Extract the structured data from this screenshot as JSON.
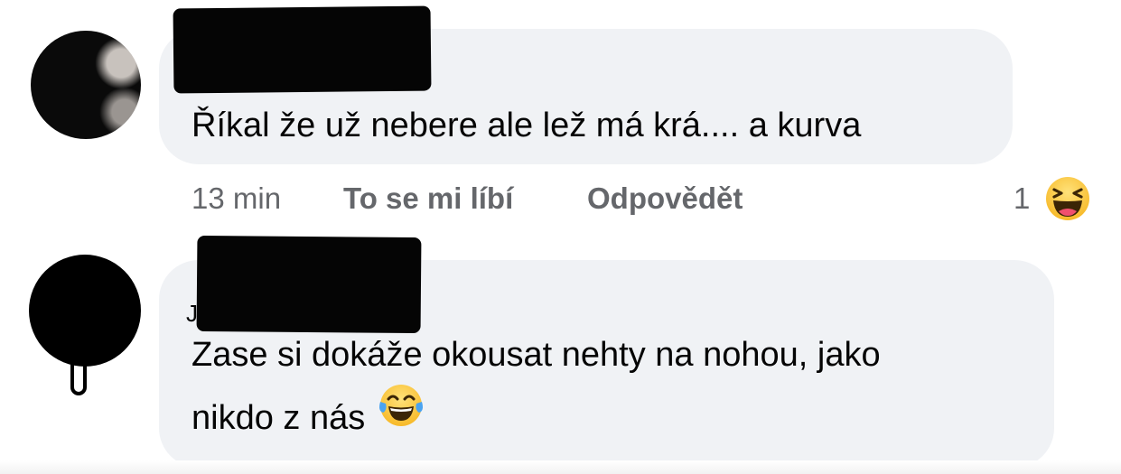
{
  "comments": [
    {
      "text": "Říkal že už nebere ale lež má krá.... a kurva",
      "time": "13 min",
      "like_label": "To se mi líbí",
      "reply_label": "Odpovědět",
      "reaction_count": "1",
      "reaction_icon": "laughing-squinting-face-icon"
    },
    {
      "author_visible_initial": "J",
      "text_line_1": "Zase si dokáže okousat nehty na nohou, jako",
      "text_line_2": "nikdo z nás",
      "emoji_icon": "face-with-tears-of-joy-icon"
    }
  ]
}
